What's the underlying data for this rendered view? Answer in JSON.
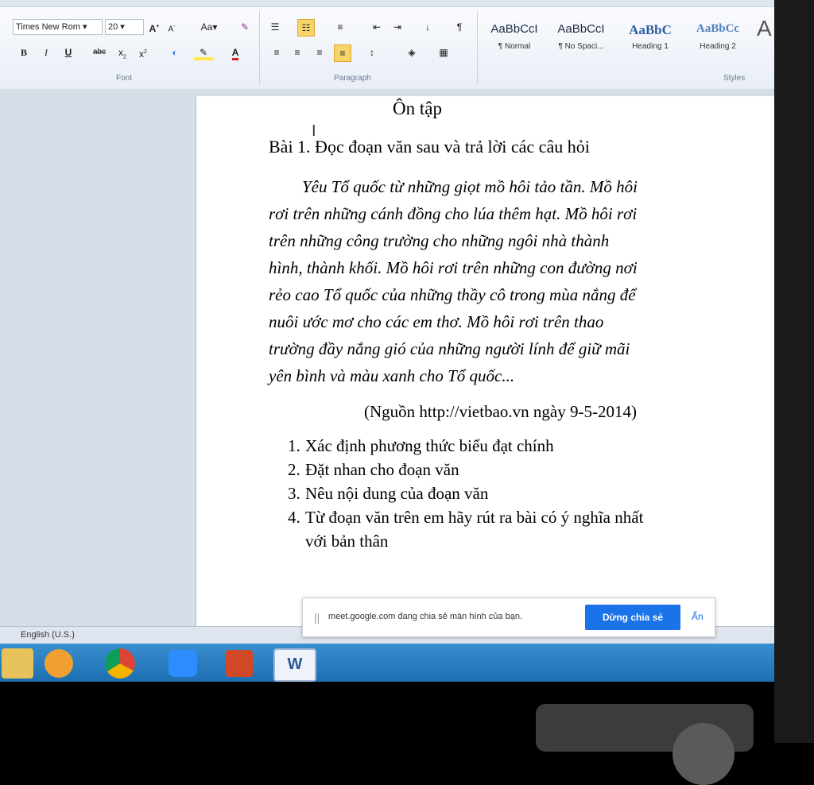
{
  "ribbon": {
    "font_name": "Times New Rom",
    "font_size": "20",
    "grow_font": "A",
    "shrink_font": "A",
    "change_case": "Aa",
    "bold": "B",
    "italic": "I",
    "underline": "U",
    "strikethrough": "abc",
    "subscript": "x",
    "superscript": "x",
    "font_color": "A",
    "pilcrow": "¶",
    "font_group": "Font",
    "paragraph_group": "Paragraph",
    "styles_group": "Styles",
    "styles": [
      {
        "preview": "AaBbCcI",
        "name": "¶ Normal"
      },
      {
        "preview": "AaBbCcI",
        "name": "¶ No Spaci..."
      },
      {
        "preview": "AaBbC",
        "name": "Heading 1"
      },
      {
        "preview": "AaBbCc",
        "name": "Heading 2"
      }
    ],
    "more_styles": "A"
  },
  "document": {
    "title": "Ôn tập",
    "heading": "Bài 1. Đọc đoạn văn sau và trả lời các câu hỏi",
    "paragraph_lines": [
      "Yêu Tổ quốc từ những giọt mồ hôi tảo tần. Mồ hôi",
      "rơi trên những cánh đồng cho lúa thêm hạt. Mồ hôi rơi",
      "trên những công trường cho những ngôi nhà thành",
      "hình, thành khối. Mồ hôi rơi trên những con đường nơi",
      "rẻo cao Tổ quốc của những thầy cô trong mùa nắng để",
      "nuôi ước mơ cho các em thơ. Mồ hôi rơi trên thao",
      "trường đầy nắng gió của những người lính để giữ mãi",
      "yên bình và màu xanh cho Tổ quốc..."
    ],
    "source": "(Nguồn http://vietbao.vn ngày 9-5-2014)",
    "questions": [
      {
        "num": "1.",
        "text": "Xác định phương thức biểu đạt chính"
      },
      {
        "num": "2.",
        "text": "Đặt nhan cho đoạn văn"
      },
      {
        "num": "3.",
        "text": "Nêu nội dung của đoạn văn"
      },
      {
        "num": "4.",
        "text": "Từ đoạn văn trên em hãy rút ra bài có ý nghĩa nhất",
        "cont": "với bản thân"
      }
    ]
  },
  "status": {
    "language": "English (U.S.)"
  },
  "share_notice": {
    "message": "meet.google.com đang chia sẻ màn hình của bạn.",
    "stop_button": "Dừng chia sẻ",
    "hide_link": "Ẩn"
  },
  "colors": {
    "accent": "#1a73e8",
    "taskbar": "#2a7fc0",
    "highlight": "#f7d46a"
  }
}
